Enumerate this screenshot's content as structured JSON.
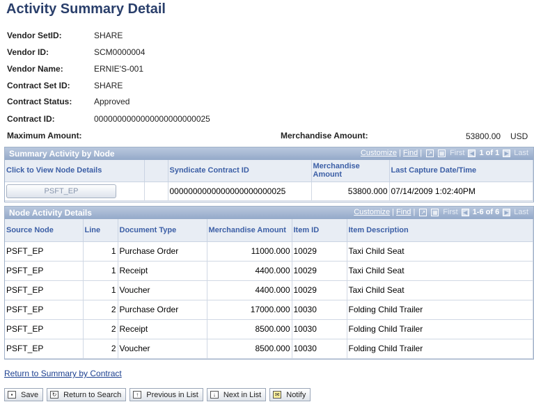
{
  "page": {
    "title": "Activity Summary Detail"
  },
  "fields": {
    "vendor_setid": {
      "label": "Vendor SetID:",
      "value": "SHARE"
    },
    "vendor_id": {
      "label": "Vendor ID:",
      "value": "SCM0000004"
    },
    "vendor_name": {
      "label": "Vendor Name:",
      "value": "ERNIE'S-001"
    },
    "contract_setid": {
      "label": "Contract Set ID:",
      "value": "SHARE"
    },
    "contract_status": {
      "label": "Contract Status:",
      "value": "Approved"
    },
    "contract_id": {
      "label": "Contract ID:",
      "value": "0000000000000000000000025"
    },
    "maximum_amount": {
      "label": "Maximum Amount:"
    },
    "merchandise_amount": {
      "label": "Merchandise Amount:",
      "value": "53800.00",
      "currency": "USD"
    }
  },
  "summary_grid": {
    "title": "Summary Activity by Node",
    "customize": "Customize",
    "find": "Find",
    "first": "First",
    "count": "1 of 1",
    "last": "Last",
    "headers": [
      "Click to View Node Details",
      "",
      "Syndicate Contract ID",
      "Merchandise Amount",
      "Last Capture Date/Time"
    ],
    "row": {
      "node_button": "PSFT_EP",
      "syndicate_contract_id": "0000000000000000000000025",
      "merchandise_amount": "53800.000",
      "last_capture": "07/14/2009  1:02:40PM"
    }
  },
  "node_grid": {
    "title": "Node Activity Details",
    "customize": "Customize",
    "find": "Find",
    "first": "First",
    "count": "1-6 of 6",
    "last": "Last",
    "headers": [
      "Source Node",
      "Line",
      "Document Type",
      "Merchandise Amount",
      "Item ID",
      "Item Description"
    ],
    "rows": [
      [
        "PSFT_EP",
        "1",
        "Purchase Order",
        "11000.000",
        "10029",
        "Taxi Child Seat"
      ],
      [
        "PSFT_EP",
        "1",
        "Receipt",
        "4400.000",
        "10029",
        "Taxi Child Seat"
      ],
      [
        "PSFT_EP",
        "1",
        "Voucher",
        "4400.000",
        "10029",
        "Taxi Child Seat"
      ],
      [
        "PSFT_EP",
        "2",
        "Purchase Order",
        "17000.000",
        "10030",
        "Folding Child Trailer"
      ],
      [
        "PSFT_EP",
        "2",
        "Receipt",
        "8500.000",
        "10030",
        "Folding Child Trailer"
      ],
      [
        "PSFT_EP",
        "2",
        "Voucher",
        "8500.000",
        "10030",
        "Folding Child Trailer"
      ]
    ]
  },
  "links": {
    "return_summary": "Return to Summary by Contract"
  },
  "toolbar": {
    "save": "Save",
    "return_search": "Return to Search",
    "previous": "Previous in List",
    "next": "Next in List",
    "notify": "Notify"
  }
}
